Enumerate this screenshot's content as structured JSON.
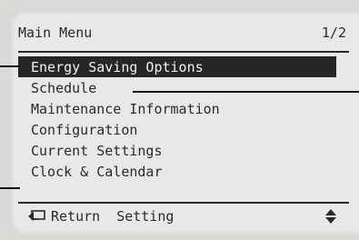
{
  "screen": {
    "title": "Main Menu",
    "page_indicator": "1/2"
  },
  "menu": {
    "items": [
      {
        "label": "Energy Saving Options",
        "selected": true
      },
      {
        "label": "Schedule",
        "selected": false
      },
      {
        "label": "Maintenance Information",
        "selected": false
      },
      {
        "label": "Configuration",
        "selected": false
      },
      {
        "label": "Current Settings",
        "selected": false
      },
      {
        "label": "Clock & Calendar",
        "selected": false
      }
    ]
  },
  "footer": {
    "return_label": "Return",
    "setting_label": "Setting",
    "icons": [
      "return-icon",
      "up-down-arrows-icon"
    ]
  },
  "colors": {
    "lcd_background": "#e8e8e6",
    "text": "#2a2a2a",
    "selected_background": "#262626",
    "selected_text": "#f2f2f2"
  }
}
